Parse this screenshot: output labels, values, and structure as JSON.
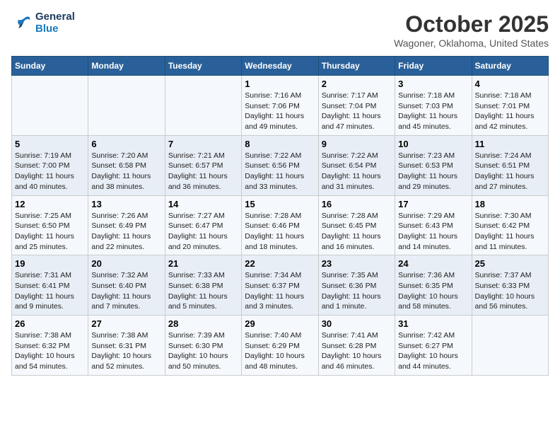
{
  "logo": {
    "line1": "General",
    "line2": "Blue"
  },
  "title": "October 2025",
  "location": "Wagoner, Oklahoma, United States",
  "days_of_week": [
    "Sunday",
    "Monday",
    "Tuesday",
    "Wednesday",
    "Thursday",
    "Friday",
    "Saturday"
  ],
  "weeks": [
    [
      {
        "num": "",
        "sunrise": "",
        "sunset": "",
        "daylight": ""
      },
      {
        "num": "",
        "sunrise": "",
        "sunset": "",
        "daylight": ""
      },
      {
        "num": "",
        "sunrise": "",
        "sunset": "",
        "daylight": ""
      },
      {
        "num": "1",
        "sunrise": "Sunrise: 7:16 AM",
        "sunset": "Sunset: 7:06 PM",
        "daylight": "Daylight: 11 hours and 49 minutes."
      },
      {
        "num": "2",
        "sunrise": "Sunrise: 7:17 AM",
        "sunset": "Sunset: 7:04 PM",
        "daylight": "Daylight: 11 hours and 47 minutes."
      },
      {
        "num": "3",
        "sunrise": "Sunrise: 7:18 AM",
        "sunset": "Sunset: 7:03 PM",
        "daylight": "Daylight: 11 hours and 45 minutes."
      },
      {
        "num": "4",
        "sunrise": "Sunrise: 7:18 AM",
        "sunset": "Sunset: 7:01 PM",
        "daylight": "Daylight: 11 hours and 42 minutes."
      }
    ],
    [
      {
        "num": "5",
        "sunrise": "Sunrise: 7:19 AM",
        "sunset": "Sunset: 7:00 PM",
        "daylight": "Daylight: 11 hours and 40 minutes."
      },
      {
        "num": "6",
        "sunrise": "Sunrise: 7:20 AM",
        "sunset": "Sunset: 6:58 PM",
        "daylight": "Daylight: 11 hours and 38 minutes."
      },
      {
        "num": "7",
        "sunrise": "Sunrise: 7:21 AM",
        "sunset": "Sunset: 6:57 PM",
        "daylight": "Daylight: 11 hours and 36 minutes."
      },
      {
        "num": "8",
        "sunrise": "Sunrise: 7:22 AM",
        "sunset": "Sunset: 6:56 PM",
        "daylight": "Daylight: 11 hours and 33 minutes."
      },
      {
        "num": "9",
        "sunrise": "Sunrise: 7:22 AM",
        "sunset": "Sunset: 6:54 PM",
        "daylight": "Daylight: 11 hours and 31 minutes."
      },
      {
        "num": "10",
        "sunrise": "Sunrise: 7:23 AM",
        "sunset": "Sunset: 6:53 PM",
        "daylight": "Daylight: 11 hours and 29 minutes."
      },
      {
        "num": "11",
        "sunrise": "Sunrise: 7:24 AM",
        "sunset": "Sunset: 6:51 PM",
        "daylight": "Daylight: 11 hours and 27 minutes."
      }
    ],
    [
      {
        "num": "12",
        "sunrise": "Sunrise: 7:25 AM",
        "sunset": "Sunset: 6:50 PM",
        "daylight": "Daylight: 11 hours and 25 minutes."
      },
      {
        "num": "13",
        "sunrise": "Sunrise: 7:26 AM",
        "sunset": "Sunset: 6:49 PM",
        "daylight": "Daylight: 11 hours and 22 minutes."
      },
      {
        "num": "14",
        "sunrise": "Sunrise: 7:27 AM",
        "sunset": "Sunset: 6:47 PM",
        "daylight": "Daylight: 11 hours and 20 minutes."
      },
      {
        "num": "15",
        "sunrise": "Sunrise: 7:28 AM",
        "sunset": "Sunset: 6:46 PM",
        "daylight": "Daylight: 11 hours and 18 minutes."
      },
      {
        "num": "16",
        "sunrise": "Sunrise: 7:28 AM",
        "sunset": "Sunset: 6:45 PM",
        "daylight": "Daylight: 11 hours and 16 minutes."
      },
      {
        "num": "17",
        "sunrise": "Sunrise: 7:29 AM",
        "sunset": "Sunset: 6:43 PM",
        "daylight": "Daylight: 11 hours and 14 minutes."
      },
      {
        "num": "18",
        "sunrise": "Sunrise: 7:30 AM",
        "sunset": "Sunset: 6:42 PM",
        "daylight": "Daylight: 11 hours and 11 minutes."
      }
    ],
    [
      {
        "num": "19",
        "sunrise": "Sunrise: 7:31 AM",
        "sunset": "Sunset: 6:41 PM",
        "daylight": "Daylight: 11 hours and 9 minutes."
      },
      {
        "num": "20",
        "sunrise": "Sunrise: 7:32 AM",
        "sunset": "Sunset: 6:40 PM",
        "daylight": "Daylight: 11 hours and 7 minutes."
      },
      {
        "num": "21",
        "sunrise": "Sunrise: 7:33 AM",
        "sunset": "Sunset: 6:38 PM",
        "daylight": "Daylight: 11 hours and 5 minutes."
      },
      {
        "num": "22",
        "sunrise": "Sunrise: 7:34 AM",
        "sunset": "Sunset: 6:37 PM",
        "daylight": "Daylight: 11 hours and 3 minutes."
      },
      {
        "num": "23",
        "sunrise": "Sunrise: 7:35 AM",
        "sunset": "Sunset: 6:36 PM",
        "daylight": "Daylight: 11 hours and 1 minute."
      },
      {
        "num": "24",
        "sunrise": "Sunrise: 7:36 AM",
        "sunset": "Sunset: 6:35 PM",
        "daylight": "Daylight: 10 hours and 58 minutes."
      },
      {
        "num": "25",
        "sunrise": "Sunrise: 7:37 AM",
        "sunset": "Sunset: 6:33 PM",
        "daylight": "Daylight: 10 hours and 56 minutes."
      }
    ],
    [
      {
        "num": "26",
        "sunrise": "Sunrise: 7:38 AM",
        "sunset": "Sunset: 6:32 PM",
        "daylight": "Daylight: 10 hours and 54 minutes."
      },
      {
        "num": "27",
        "sunrise": "Sunrise: 7:38 AM",
        "sunset": "Sunset: 6:31 PM",
        "daylight": "Daylight: 10 hours and 52 minutes."
      },
      {
        "num": "28",
        "sunrise": "Sunrise: 7:39 AM",
        "sunset": "Sunset: 6:30 PM",
        "daylight": "Daylight: 10 hours and 50 minutes."
      },
      {
        "num": "29",
        "sunrise": "Sunrise: 7:40 AM",
        "sunset": "Sunset: 6:29 PM",
        "daylight": "Daylight: 10 hours and 48 minutes."
      },
      {
        "num": "30",
        "sunrise": "Sunrise: 7:41 AM",
        "sunset": "Sunset: 6:28 PM",
        "daylight": "Daylight: 10 hours and 46 minutes."
      },
      {
        "num": "31",
        "sunrise": "Sunrise: 7:42 AM",
        "sunset": "Sunset: 6:27 PM",
        "daylight": "Daylight: 10 hours and 44 minutes."
      },
      {
        "num": "",
        "sunrise": "",
        "sunset": "",
        "daylight": ""
      }
    ]
  ]
}
